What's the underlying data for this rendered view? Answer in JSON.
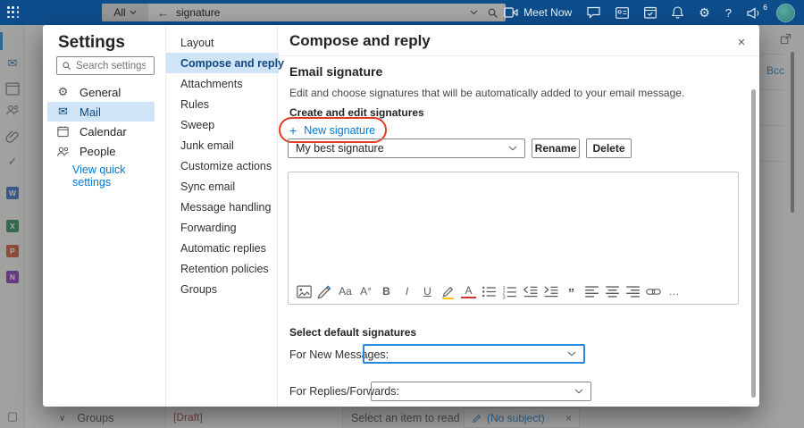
{
  "topbar": {
    "search_scope": "All",
    "search_value": "signature",
    "meet_now": "Meet Now",
    "badge": "6",
    "help": "?",
    "icons": [
      "app-launcher-icon",
      "back-icon",
      "chevron-down-icon",
      "search-icon",
      "camera-icon",
      "chat-icon",
      "contact-card-icon",
      "calendar-check-icon",
      "bell-icon",
      "gear-icon",
      "help-icon",
      "megaphone-icon",
      "avatar"
    ]
  },
  "settings": {
    "title": "Settings",
    "search_placeholder": "Search settings",
    "items": [
      {
        "label": "General",
        "icon": "gear-icon"
      },
      {
        "label": "Mail",
        "icon": "mail-icon"
      },
      {
        "label": "Calendar",
        "icon": "calendar-icon"
      },
      {
        "label": "People",
        "icon": "people-icon"
      }
    ],
    "selected_item": "Mail",
    "quick_link": "View quick settings"
  },
  "nav": {
    "selected": "Compose and reply",
    "items": [
      {
        "label": "Layout"
      },
      {
        "label": "Compose and reply"
      },
      {
        "label": "Attachments"
      },
      {
        "label": "Rules"
      },
      {
        "label": "Sweep"
      },
      {
        "label": "Junk email"
      },
      {
        "label": "Customize actions"
      },
      {
        "label": "Sync email"
      },
      {
        "label": "Message handling"
      },
      {
        "label": "Forwarding"
      },
      {
        "label": "Automatic replies"
      },
      {
        "label": "Retention policies"
      },
      {
        "label": "Groups"
      }
    ]
  },
  "panel": {
    "title": "Compose and reply",
    "section": "Email signature",
    "description": "Edit and choose signatures that will be automatically added to your email message.",
    "create_label": "Create and edit signatures",
    "new_signature": "New signature",
    "signature_name": "My best signature",
    "rename": "Rename",
    "delete": "Delete",
    "defaults_heading": "Select default signatures",
    "for_new": "For New Messages:",
    "for_new_value": "",
    "for_replies": "For Replies/Forwards:",
    "for_replies_value": ""
  },
  "editor_toolbar": {
    "icons": [
      "picture-icon",
      "format-painter-icon",
      "font-icon",
      "font-size-icon",
      "bold-icon",
      "italic-icon",
      "underline-icon",
      "highlight-icon",
      "font-color-icon",
      "bullet-list-icon",
      "numbered-list-icon",
      "outdent-icon",
      "indent-icon",
      "quote-icon",
      "align-left-icon",
      "align-center-icon",
      "align-right-icon",
      "link-icon",
      "more-icon"
    ]
  },
  "background": {
    "groups": "Groups",
    "draft": "[Draft]",
    "reading_placeholder": "Select an item to read",
    "compose_tab": "(No subject)",
    "bcc": "Bcc",
    "app_icons": [
      {
        "label": "W",
        "color": "#185abd"
      },
      {
        "label": "X",
        "color": "#107c41"
      },
      {
        "label": "P",
        "color": "#c43e1c"
      },
      {
        "label": "N",
        "color": "#7719aa"
      }
    ]
  },
  "glyphs": {
    "plus": "+",
    "back": "←",
    "close": "×",
    "more": "…",
    "quote": "”",
    "font": "Aa",
    "font_size": "A°",
    "bold": "B",
    "italic": "I",
    "underline": "U",
    "font_color": "A",
    "gear": "⚙",
    "mail": "✉",
    "check": "✓",
    "chevron": "∨",
    "hamburger": "≡",
    "slash": "⊘",
    "square": "▢"
  },
  "colors": {
    "topbar": "#0d4d8c",
    "accent": "#0078d4",
    "selected_bg": "#cfe4f7",
    "annotation_red": "#e23b26",
    "draft_red": "#a4262c",
    "avatar_teal": "#3c9188"
  }
}
